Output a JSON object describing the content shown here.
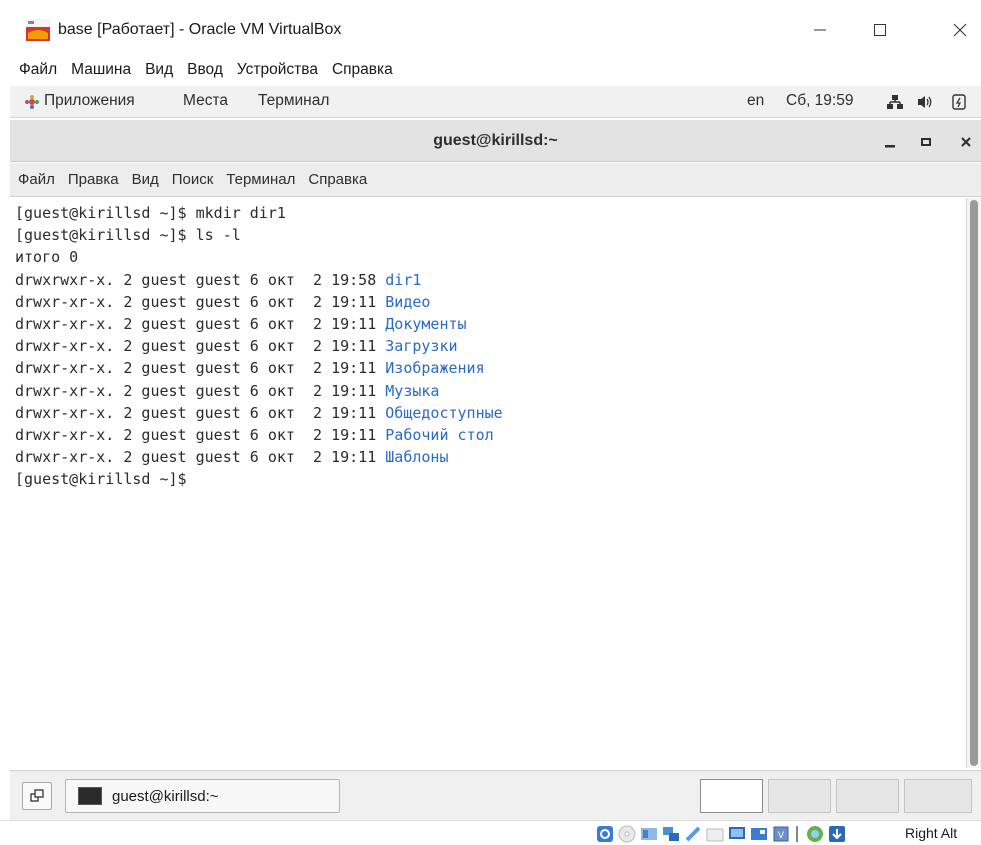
{
  "host_window": {
    "title": "base [Работает] - Oracle VM VirtualBox",
    "menu": [
      "Файл",
      "Машина",
      "Вид",
      "Ввод",
      "Устройства",
      "Справка"
    ]
  },
  "guest_panel": {
    "apps": "Приложения",
    "places": "Места",
    "terminal": "Терминал",
    "keyboard_layout": "en",
    "clock": "Сб, 19:59"
  },
  "terminal": {
    "title": "guest@kirillsd:~",
    "menu": [
      "Файл",
      "Правка",
      "Вид",
      "Поиск",
      "Терминал",
      "Справка"
    ],
    "lines": [
      {
        "text": "[guest@kirillsd ~]$ mkdir dir1",
        "name": ""
      },
      {
        "text": "[guest@kirillsd ~]$ ls -l",
        "name": ""
      },
      {
        "text": "итого 0",
        "name": ""
      },
      {
        "text": "drwxrwxr-x. 2 guest guest 6 окт  2 19:58 ",
        "name": "dir1"
      },
      {
        "text": "drwxr-xr-x. 2 guest guest 6 окт  2 19:11 ",
        "name": "Видео"
      },
      {
        "text": "drwxr-xr-x. 2 guest guest 6 окт  2 19:11 ",
        "name": "Документы"
      },
      {
        "text": "drwxr-xr-x. 2 guest guest 6 окт  2 19:11 ",
        "name": "Загрузки"
      },
      {
        "text": "drwxr-xr-x. 2 guest guest 6 окт  2 19:11 ",
        "name": "Изображения"
      },
      {
        "text": "drwxr-xr-x. 2 guest guest 6 окт  2 19:11 ",
        "name": "Музыка"
      },
      {
        "text": "drwxr-xr-x. 2 guest guest 6 окт  2 19:11 ",
        "name": "Общедоступные"
      },
      {
        "text": "drwxr-xr-x. 2 guest guest 6 окт  2 19:11 ",
        "name": "Рабочий стол"
      },
      {
        "text": "drwxr-xr-x. 2 guest guest 6 окт  2 19:11 ",
        "name": "Шаблоны"
      },
      {
        "text": "[guest@kirillsd ~]$",
        "name": ""
      }
    ],
    "dir_color": "#2a6ac8"
  },
  "guest_taskbar": {
    "task_label": "guest@kirillsd:~"
  },
  "host_status": {
    "host_key": "Right Alt",
    "icons": [
      "hard-disk-icon",
      "optical-drive-icon",
      "audio-icon",
      "network-icon",
      "usb-icon",
      "shared-folders-icon",
      "display-icon",
      "recording-icon",
      "cpu-icon",
      "mouse-integration-icon",
      "keyboard-capture-icon"
    ]
  }
}
